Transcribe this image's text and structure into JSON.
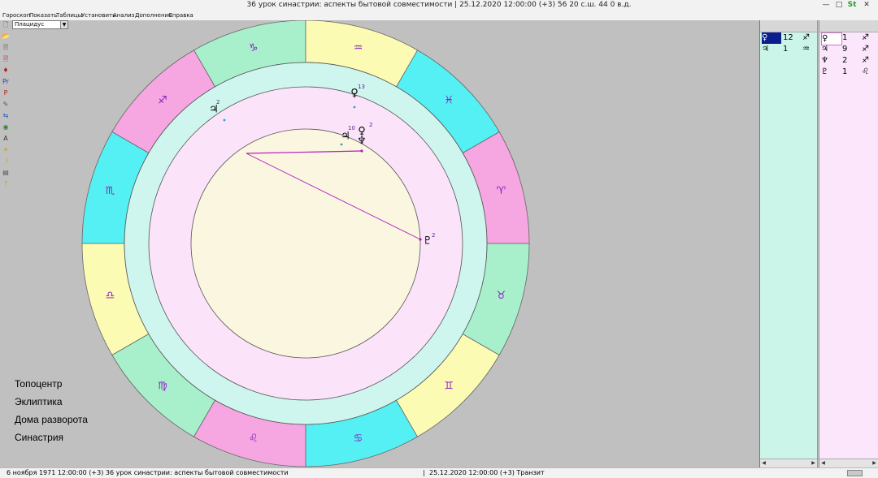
{
  "window": {
    "title": "36 урок синастрии: аспекты бытовой совместимости |   25.12.2020 12:00:00 (+3)   56 20 с.ш. 44 0 в.д.",
    "logo": "St"
  },
  "menu": [
    "Гороскоп",
    "Показать",
    "Таблицы",
    "Установить",
    "Анализ",
    "Дополнения",
    "Справка"
  ],
  "house_system": "Плацидус",
  "toolbar_icons": [
    "new-chart-icon",
    "open-folder-icon",
    "page-icon",
    "page-red-icon",
    "planets-icon",
    "pr-icon",
    "p-icon",
    "edit-icon",
    "aspects-icon",
    "globe-icon",
    "a-text-icon",
    "sun-icon",
    "moon-icon",
    "book-icon",
    "help-icon"
  ],
  "toolbar_glyphs": [
    "🗋",
    "📂",
    "🗎",
    "🗎",
    "♦",
    "Pr",
    "P",
    "✎",
    "⇆",
    "◉",
    "A",
    "☀",
    "☽",
    "▤",
    "?"
  ],
  "zodiac_signs": [
    "♑",
    "♐",
    "♏",
    "♎",
    "♍",
    "♌",
    "♋",
    "♊",
    "♉",
    "♈",
    "♓",
    "♒"
  ],
  "zodiac_colors": [
    "#a8f0cc",
    "#f6a6e0",
    "#55f0f4",
    "#fbfbb4",
    "#a8f0cc",
    "#f6a6e0",
    "#55f0f4",
    "#fbfbb4",
    "#a8f0cc",
    "#f6a6e0",
    "#55f0f4",
    "#fbfbb4"
  ],
  "colors": {
    "outer_band": "#cff6ee",
    "middle_band": "#fbe3fa",
    "inner_disc": "#fbf6df",
    "aspect_line": "#b21cc0",
    "sign_glyph": "#8a1cc0"
  },
  "chart_planets": [
    {
      "glyph": "♃",
      "degree": "2",
      "ring": "outer"
    },
    {
      "glyph": "♀",
      "degree": "13",
      "ring": "outer"
    },
    {
      "glyph": "♃",
      "degree": "10",
      "ring": "inner"
    },
    {
      "glyph": "♀",
      "degree": "2",
      "ring": "inner"
    },
    {
      "glyph": "♆",
      "degree": "",
      "ring": "inner"
    },
    {
      "glyph": "♇",
      "degree": "2",
      "ring": "inner"
    }
  ],
  "options": [
    "Топоцентр",
    "Эклиптика",
    "Дома разворота",
    "Синастрия"
  ],
  "table_left": [
    {
      "planet": "♀",
      "degree": "12",
      "sign": "♐",
      "selected": true
    },
    {
      "planet": "♃",
      "degree": "1",
      "sign": "♒",
      "selected": false
    }
  ],
  "table_right": [
    {
      "planet": "♀",
      "degree": "1",
      "sign": "♐",
      "selected": true
    },
    {
      "planet": "♃",
      "degree": "9",
      "sign": "♐",
      "selected": false
    },
    {
      "planet": "♆",
      "degree": "2",
      "sign": "♐",
      "selected": false
    },
    {
      "planet": "♇",
      "degree": "1",
      "sign": "♌",
      "selected": false
    }
  ],
  "status": {
    "left": "6 ноября 1971  12:00:00 (+3)   36 урок синастрии: аспекты бытовой совместимости",
    "right": "25.12.2020 12:00:00 (+3)   Транзит"
  }
}
